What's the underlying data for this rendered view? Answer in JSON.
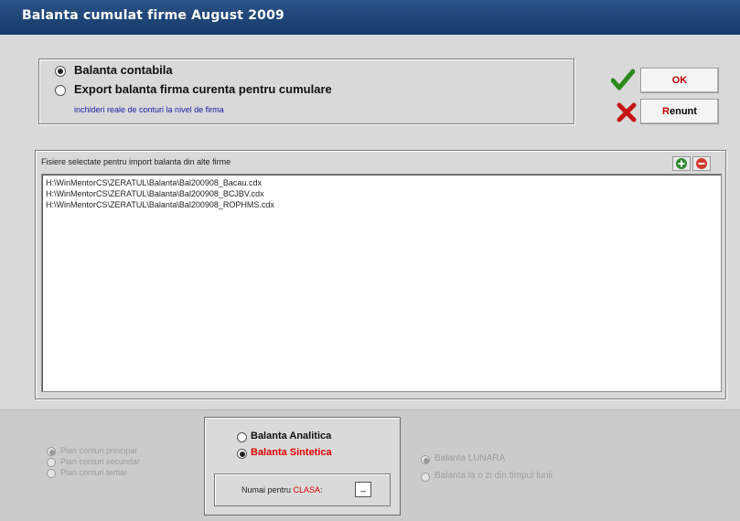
{
  "window": {
    "title": "Balanta cumulat firme August 2009"
  },
  "options": {
    "items": [
      {
        "label": "Balanta contabila",
        "selected": true
      },
      {
        "label": "Export balanta firma curenta pentru cumulare",
        "selected": false
      }
    ],
    "note": "inchideri reale de conturi la nivel de firma",
    "note_color": "#1a1aa6"
  },
  "buttons": {
    "ok": {
      "label": "OK",
      "icon": "check-icon",
      "color": "#c00000"
    },
    "cancel": {
      "hot": "R",
      "rest": "enunt",
      "icon": "x-mark-icon",
      "color": "#c00000"
    }
  },
  "files": {
    "header": "Fisiere selectate pentru import balanta din alte firme",
    "items": [
      "H:\\WinMentorCS\\ZERATUL\\Balanta\\Bal200908_Bacau.cdx",
      "H:\\WinMentorCS\\ZERATUL\\Balanta\\Bal200908_BCJBV.cdx",
      "H:\\WinMentorCS\\ZERATUL\\Balanta\\Bal200908_ROPHMS.cdx"
    ],
    "add_icon": "plus-icon",
    "remove_icon": "minus-icon"
  },
  "plan": {
    "items": [
      {
        "label": "Plan conturi principal",
        "selected": true
      },
      {
        "label": "Plan conturi secundar",
        "selected": false
      },
      {
        "label": "Plan conturi tertiar",
        "selected": false
      }
    ]
  },
  "balance_type": {
    "items": [
      {
        "label": "Balanta Analitica",
        "selected": false
      },
      {
        "label": "Balanta Sintetica",
        "selected": true
      }
    ],
    "class_label_prefix": "Numai pentru ",
    "class_label_hot": "CLASA",
    "class_label_suffix": ":",
    "class_value": "_",
    "hot_color": "#e00000"
  },
  "period": {
    "items": [
      {
        "label": "Balanta LUNARA",
        "selected": true
      },
      {
        "label": "Balanta la o zi din timpul lunii",
        "selected": false
      }
    ]
  }
}
